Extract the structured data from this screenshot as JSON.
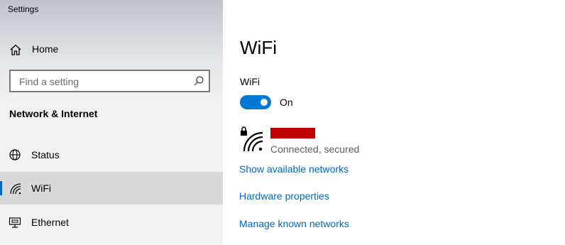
{
  "window": {
    "title": "Settings"
  },
  "sidebar": {
    "home_label": "Home",
    "search_placeholder": "Find a setting",
    "section_title": "Network & Internet",
    "items": [
      {
        "label": "Status",
        "icon": "globe-icon",
        "selected": false
      },
      {
        "label": "WiFi",
        "icon": "wifi-icon",
        "selected": true
      },
      {
        "label": "Ethernet",
        "icon": "ethernet-icon",
        "selected": false
      }
    ]
  },
  "main": {
    "title": "WiFi",
    "wifi_label": "WiFi",
    "toggle_state": "On",
    "network": {
      "status": "Connected, secured",
      "secured": true
    },
    "links": [
      "Show available networks",
      "Hardware properties",
      "Manage known networks"
    ]
  },
  "colors": {
    "accent": "#0078d4",
    "link": "#0067c0",
    "redaction": "#c00000"
  }
}
